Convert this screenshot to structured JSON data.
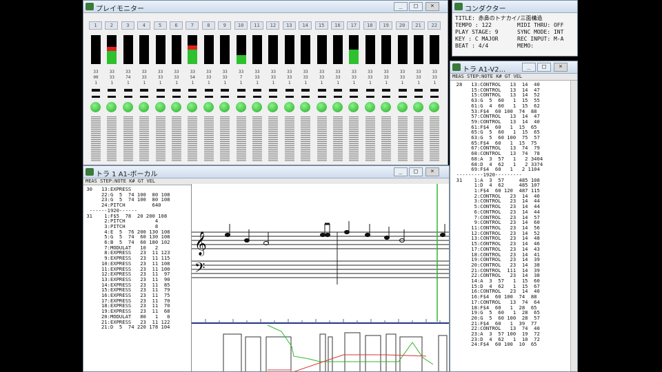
{
  "monitor": {
    "title": "プレイモニター",
    "btn_min": "_",
    "btn_max": "□",
    "btn_close": "×",
    "channels": [
      {
        "n": "1",
        "lvl": 0,
        "pk": 0,
        "t1": "33",
        "t2": "00",
        "t3": "1"
      },
      {
        "n": "2",
        "lvl": 0.45,
        "pk": 1,
        "t1": "33",
        "t2": "33",
        "t3": "1"
      },
      {
        "n": "3",
        "lvl": 0,
        "pk": 0,
        "t1": "33",
        "t2": "74",
        "t3": "1"
      },
      {
        "n": "4",
        "lvl": 0,
        "pk": 0,
        "t1": "33",
        "t2": "33",
        "t3": "1"
      },
      {
        "n": "5",
        "lvl": 0,
        "pk": 0,
        "t1": "33",
        "t2": "33",
        "t3": "1"
      },
      {
        "n": "6",
        "lvl": 0,
        "pk": 0,
        "t1": "33",
        "t2": "33",
        "t3": "1"
      },
      {
        "n": "7",
        "lvl": 0.5,
        "pk": 1,
        "t1": "33",
        "t2": "54",
        "t3": "1"
      },
      {
        "n": "8",
        "lvl": 0,
        "pk": 0,
        "t1": "33",
        "t2": "33",
        "t3": "1"
      },
      {
        "n": "9",
        "lvl": 0,
        "pk": 0,
        "t1": "33",
        "t2": "33",
        "t3": "1"
      },
      {
        "n": "10",
        "lvl": 0.3,
        "pk": 0,
        "t1": "33",
        "t2": "7",
        "t3": "1"
      },
      {
        "n": "11",
        "lvl": 0,
        "pk": 0,
        "t1": "33",
        "t2": "33",
        "t3": "1"
      },
      {
        "n": "12",
        "lvl": 0,
        "pk": 0,
        "t1": "33",
        "t2": "33",
        "t3": "1"
      },
      {
        "n": "13",
        "lvl": 0,
        "pk": 0,
        "t1": "33",
        "t2": "33",
        "t3": "1"
      },
      {
        "n": "14",
        "lvl": 0,
        "pk": 0,
        "t1": "33",
        "t2": "33",
        "t3": "1"
      },
      {
        "n": "15",
        "lvl": 0,
        "pk": 0,
        "t1": "33",
        "t2": "33",
        "t3": "1"
      },
      {
        "n": "16",
        "lvl": 0,
        "pk": 0,
        "t1": "33",
        "t2": "33",
        "t3": "1"
      },
      {
        "n": "17",
        "lvl": 0.5,
        "pk": 0,
        "t1": "33",
        "t2": "33",
        "t3": "1"
      },
      {
        "n": "18",
        "lvl": 0,
        "pk": 0,
        "t1": "33",
        "t2": "33",
        "t3": "1"
      },
      {
        "n": "19",
        "lvl": 0,
        "pk": 0,
        "t1": "33",
        "t2": "33",
        "t3": "1"
      },
      {
        "n": "20",
        "lvl": 0,
        "pk": 0,
        "t1": "33",
        "t2": "33",
        "t3": "1"
      },
      {
        "n": "21",
        "lvl": 0,
        "pk": 0,
        "t1": "33",
        "t2": "33",
        "t3": "1"
      },
      {
        "n": "22",
        "lvl": 0,
        "pk": 0,
        "t1": "33",
        "t2": "33",
        "t3": "1"
      }
    ]
  },
  "counter": {
    "title": "コンダクター",
    "title_line": "TITLE: 赤鼻のトナカイ/三面構造",
    "rows": [
      [
        "TEMPO  :  122",
        "MIDI THRU:  OFF"
      ],
      [
        "PLAY STAGE:  9",
        "SYNC MODE:  INT"
      ],
      [
        "KEY  : C MAJOR",
        "REC INPUT:  M-A"
      ],
      [
        "BEAT   :  4/4",
        "MEMO:"
      ]
    ]
  },
  "listR": {
    "title": "トラ  A1-V2...",
    "header": "MEAS STEP:NOTE K# GT VEL",
    "lines": [
      "  28   13:CONTROL   13  14  40",
      "       15:CONTROL   13  14  47",
      "       15:CONTROL   13  14  52",
      "       63:G  5  60   1  15  55",
      "       61:G  4  60   1  15  62",
      "       53:F$4  60 100  74  88",
      "       57:CONTROL   13  14  47",
      "       59:CONTROL   13  14  40",
      "       61:F$4  60   1  15  65",
      "       65:G  5  60   1  15  65",
      "       63:G  5  60 100  75  57",
      "       65:F$4  60   1  15  75",
      "       67:CONTROL   13  74  79",
      "       68:CONTROL   13  74  78",
      "       68:A  3  57   1   2 3404",
      "       68:D  4  62   1   2 3374",
      "       69:F$4  60   1   2 1104",
      "  ---------1920---------",
      "  31    1:A  3  57     485 108",
      "        1:D  4  62     485 107",
      "        1:F$4  60 120  487 115",
      "        2:CONTROL   23  14  40",
      "        3:CONTROL   23  14  44",
      "        5:CONTROL   23  14  44",
      "        6:CONTROL   23  14  44",
      "        7:CONTROL   23  14  57",
      "        9:CONTROL   23  14  60",
      "       11:CONTROL   23  14  56",
      "       12:CONTROL   23  14  52",
      "       13:CONTROL   23  14  48",
      "       15:CONTROL   23  14  46",
      "       17:CONTROL   23  14  43",
      "       18:CONTROL   23  14  41",
      "       19:CONTROL   23  14  39",
      "       20:CONTROL   23  14  38",
      "       21:CONTROL  111  14  39",
      "       22:CONTROL   23  14  38",
      "       14:A  3  57   1  15  60",
      "       15:D  4  62   1  15  67",
      "       16:CONTROL   23  14  40",
      "       16:F$4  60 100  74  88",
      "       17:CONTROL   13  74  64",
      "       18:F$4  60   1  28  65",
      "       19:G  5  60   1  28  65",
      "       20:G  5  60 100  28  57",
      "       21:F$4  60   1  39  77",
      "       22:CONTROL   13  74  40",
      "       23:A  3  57 100  19  72",
      "       23:D  4  62   1  10  72",
      "       24:F$4  60 100  10  65"
    ]
  },
  "listL": {
    "title": "トラ 1  A1-ボーカル",
    "header": "MEAS STEP:NOTE K# GT VEL",
    "lines": [
      " 30   13:EXPRESS  ",
      "      22:G  5  74 100  80 108",
      "      23:G  5  74 100  80 108",
      "      24:PITCH         640",
      "  ------1920------",
      " 31    1:F$5  78  20 200 108",
      "       2:PITCH          4",
      "       3:PITCH          8",
      "       4:E  5  76 200 130 108",
      "       5:G  5  74  60 130 108",
      "       6:B  5  74  60 180 102",
      "       7:MODULAT   10   2",
      "       8:EXPRESS   23  11 123",
      "       9:EXPRESS   23  11 115",
      "      10:EXPRESS   23  11 108",
      "      11:EXPRESS   23  11 100",
      "      12:EXPRESS   23  11  97",
      "      13:EXPRESS   23  11  90",
      "      14:EXPRESS   23  11  85",
      "      15:EXPRESS   23  11  79",
      "      16:EXPRESS   23  11  75",
      "      17:EXPRESS   23  11  70",
      "      18:EXPRESS   23  11  70",
      "      19:EXPRESS   23  11  68",
      "      20:MODULAT   80   1   0",
      "      21:EXPRESS   23  11 122",
      "      21:D  5  74 220 178 104"
    ]
  }
}
